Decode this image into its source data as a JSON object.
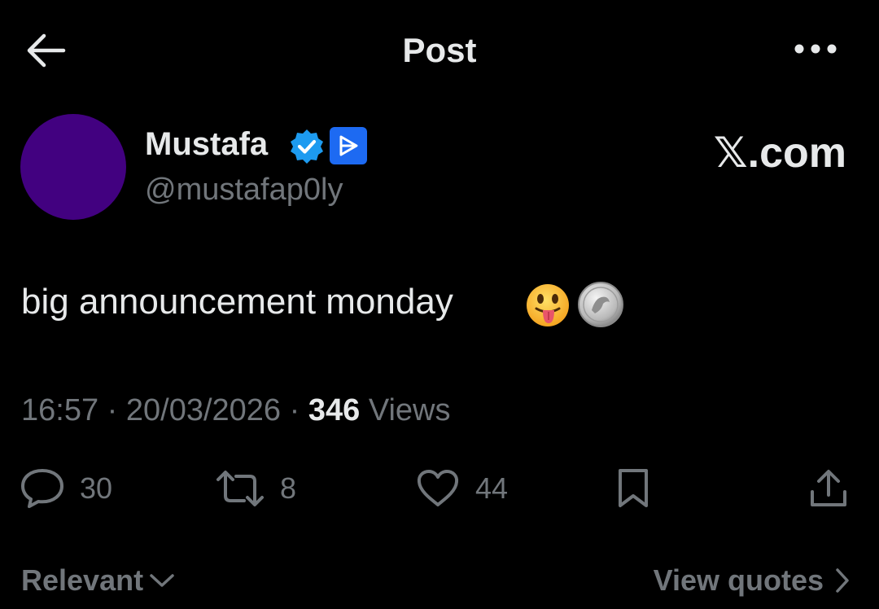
{
  "header": {
    "title": "Post",
    "back_icon": "arrow-left-icon",
    "more_icon": "more-horizontal-icon"
  },
  "author": {
    "name": "Mustafa",
    "handle": "@mustafap0ly",
    "avatar_color": "#420180",
    "verified_icon": "verified-badge-icon",
    "verified_color": "#1d9bf0",
    "affiliate_icon": "affiliate-badge-icon",
    "affiliate_color": "#1d6af2"
  },
  "watermark": "𝕏.com",
  "post": {
    "text": "big announcement monday",
    "emojis": [
      "face-with-tongue-icon",
      "silver-coin-icon"
    ]
  },
  "meta": {
    "time": "16:57",
    "separator": "·",
    "date": "20/03/2026",
    "views_count": "346",
    "views_label": "Views"
  },
  "actions": {
    "replies": "30",
    "reposts": "8",
    "likes": "44",
    "reply_icon": "reply-bubble-icon",
    "repost_icon": "repost-icon",
    "like_icon": "heart-icon",
    "bookmark_icon": "bookmark-icon",
    "share_icon": "share-icon"
  },
  "footer": {
    "sort_label": "Relevant",
    "view_quotes_label": "View quotes"
  },
  "colors": {
    "background": "#000000",
    "primary_text": "#e7e9ea",
    "secondary_text": "#71767b"
  }
}
